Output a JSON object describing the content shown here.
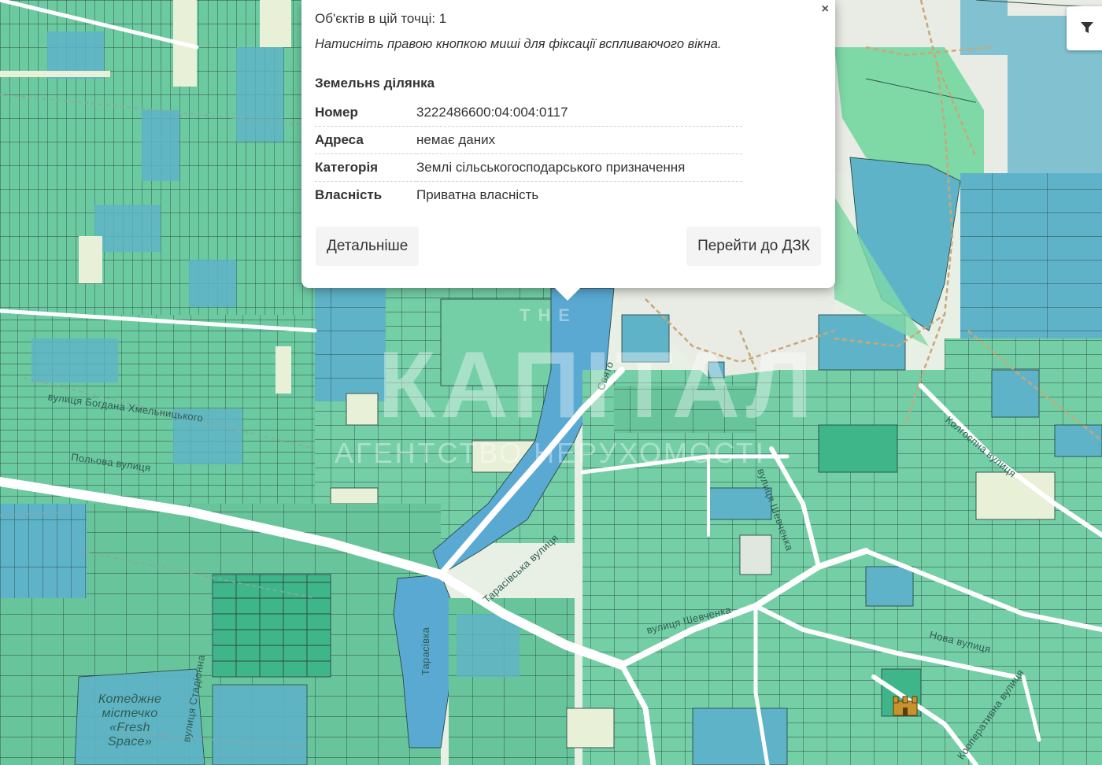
{
  "popup": {
    "count_text": "Об'єктів в цій точці: 1",
    "hint_text": "Натисніть правою кнопкою миші для фіксації вспливаючого вікна.",
    "section_title": "Земельнs ділянка",
    "close_label": "×",
    "rows": [
      {
        "label": "Номер",
        "value": "3222486600:04:004:0117"
      },
      {
        "label": "Адреса",
        "value": "немає даних"
      },
      {
        "label": "Категорія",
        "value": "Землі сільськогосподарського призначення"
      },
      {
        "label": "Власність",
        "value": "Приватна власність"
      }
    ],
    "details_button": "Детальніше",
    "goto_button": "Перейти до ДЗК"
  },
  "map": {
    "filter_icon": "filter-icon",
    "landmark_icon": "castle-icon",
    "colors": {
      "parcel_green": "#6ccaa0",
      "parcel_blue": "#5fb3c9",
      "parcel_dark": "#3fb58a",
      "road": "#ffffff",
      "river": "#5aa9d3",
      "outline": "#2b4a44",
      "background": "#e8efe4"
    },
    "streets": [
      "вулиця Шевченка",
      "Нова вулиця",
      "Кооперативна вулиця",
      "Тарасівська вулиця",
      "Тарасівка",
      "вулиця Богдана Хмельницького",
      "Польова вулиця",
      "вулиця Стадіонна",
      "Колгоспна вулиця",
      "вулиця Шевченка",
      "Свято"
    ],
    "places": [
      "Котеджне містечко «Fresh Space»"
    ]
  },
  "watermark": {
    "top": "THE",
    "middle": "КАПІТАЛ",
    "bottom": "АГЕНТСТВО НЕРУХОМОСТІ"
  }
}
